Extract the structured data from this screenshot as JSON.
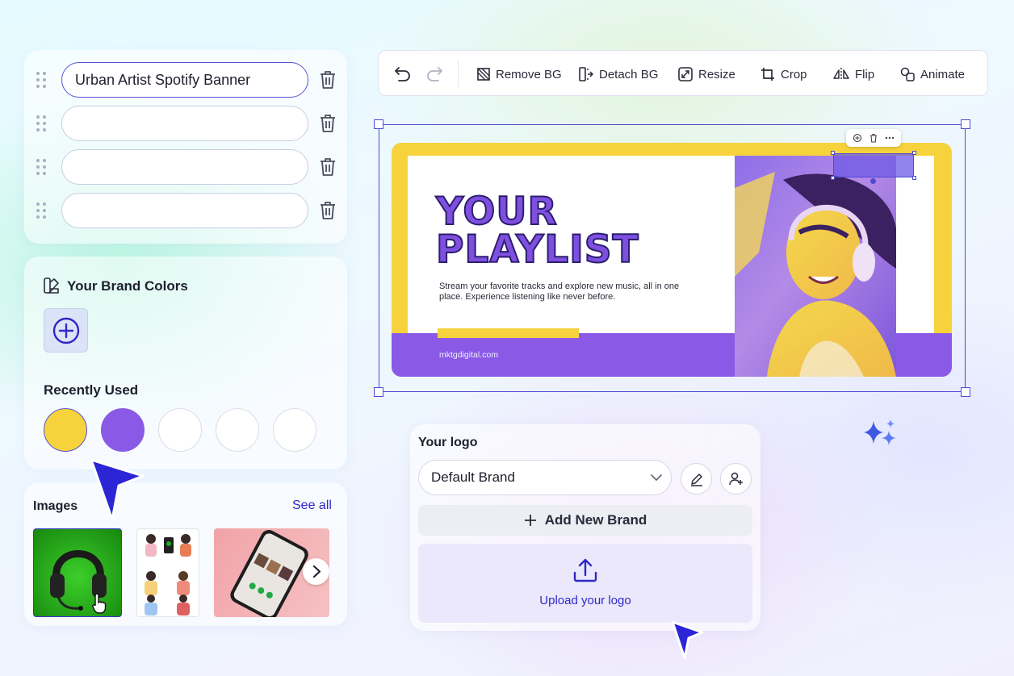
{
  "title_rows": [
    {
      "value": "Urban Artist Spotify Banner",
      "active": true
    },
    {
      "value": "",
      "active": false
    },
    {
      "value": "",
      "active": false
    },
    {
      "value": "",
      "active": false
    }
  ],
  "brand_colors": {
    "title": "Your Brand Colors",
    "recent_title": "Recently Used",
    "recent_swatches": [
      "#f6d33d",
      "#8a5ae6",
      "#ffffff",
      "#ffffff",
      "#ffffff"
    ]
  },
  "images": {
    "title": "Images",
    "see_all": "See all"
  },
  "toolbar": {
    "remove_bg": "Remove BG",
    "detach_bg": "Detach BG",
    "resize": "Resize",
    "crop": "Crop",
    "flip": "Flip",
    "animate": "Animate"
  },
  "banner": {
    "headline_1": "YOUR",
    "headline_2": "PLAYLIST",
    "subline": "Stream your favorite tracks and explore new music, all in one place. Experience listening like never before.",
    "url": "mktgdigital.com",
    "colors": {
      "yellow": "#f6d33d",
      "purple": "#8a5ae6"
    }
  },
  "logo": {
    "title": "Your logo",
    "selected_brand": "Default Brand",
    "add_brand": "Add New Brand",
    "upload": "Upload your logo"
  },
  "accent": "#3f36d8"
}
